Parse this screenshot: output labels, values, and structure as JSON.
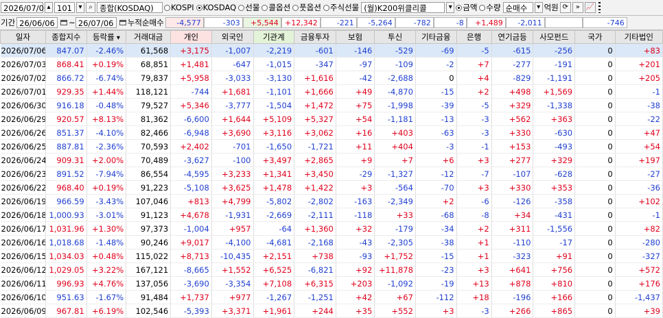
{
  "toolbar": {
    "date": "2026/07/06",
    "code": "101",
    "index_name": "종합(KOSDAQ)",
    "markets": [
      {
        "label": "KOSPI",
        "checked": false
      },
      {
        "label": "KOSDAQ",
        "checked": true
      },
      {
        "label": "선물",
        "checked": false
      },
      {
        "label": "콜옵션",
        "checked": false
      },
      {
        "label": "풋옵션",
        "checked": false
      },
      {
        "label": "주식선물",
        "checked": false
      }
    ],
    "unit": "(월)K200위클리콜",
    "measures": [
      {
        "label": "금액",
        "checked": true
      },
      {
        "label": "수량",
        "checked": false
      }
    ],
    "mode": "순매수",
    "amount_unit": "억원"
  },
  "period": {
    "label": "기간",
    "from": "26/06/06",
    "tilde": "~",
    "to": "26/07/06",
    "sum_label": "누적순매수",
    "sums": [
      "-4,577",
      "-303",
      "+5,544",
      "+12,342",
      "-221",
      "-5,264",
      "-782",
      "-8",
      "+1,489",
      "-2,011",
      "",
      "-746"
    ]
  },
  "headers": [
    "일자",
    "종합지수",
    "등락률",
    "거래대금",
    "개인",
    "외국인",
    "기관계",
    "금융투자",
    "보험",
    "투신",
    "기타금융",
    "은행",
    "연기금등",
    "사모펀드",
    "국가",
    "기타법인"
  ],
  "rows": [
    [
      "2026/07/06",
      "847.07",
      "-2.46%",
      "61,568",
      "+3,175",
      "-1,007",
      "-2,219",
      "-601",
      "-146",
      "-529",
      "-69",
      "-5",
      "-615",
      "-256",
      "0",
      "+83"
    ],
    [
      "2026/07/03",
      "868.41",
      "+0.19%",
      "68,851",
      "+1,481",
      "-647",
      "-1,015",
      "-347",
      "-97",
      "-109",
      "-2",
      "+7",
      "-277",
      "-191",
      "0",
      "+201"
    ],
    [
      "2026/07/02",
      "866.72",
      "-6.74%",
      "79,837",
      "+5,958",
      "-3,033",
      "-3,130",
      "+1,616",
      "-42",
      "-2,688",
      "0",
      "+4",
      "-829",
      "-1,191",
      "0",
      "+205"
    ],
    [
      "2026/07/01",
      "929.35",
      "+1.44%",
      "118,121",
      "-744",
      "+1,681",
      "-1,101",
      "+1,666",
      "+49",
      "-4,870",
      "-15",
      "+2",
      "+498",
      "+1,569",
      "0",
      "-1"
    ],
    [
      "2026/06/30",
      "916.18",
      "-0.48%",
      "79,527",
      "+5,346",
      "-3,777",
      "-1,504",
      "+1,472",
      "+75",
      "-1,998",
      "-39",
      "-5",
      "+329",
      "-1,338",
      "0",
      "-38"
    ],
    [
      "2026/06/29",
      "920.57",
      "+8.13%",
      "81,362",
      "-6,600",
      "+1,644",
      "+5,109",
      "+5,327",
      "+54",
      "-1,181",
      "-13",
      "-3",
      "+562",
      "+363",
      "0",
      "-22"
    ],
    [
      "2026/06/26",
      "851.37",
      "-4.10%",
      "82,466",
      "-6,948",
      "+3,690",
      "+3,116",
      "+3,062",
      "+16",
      "+403",
      "-63",
      "-3",
      "+330",
      "-630",
      "0",
      "+47"
    ],
    [
      "2026/06/25",
      "887.81",
      "-2.36%",
      "70,593",
      "+2,402",
      "-701",
      "-1,650",
      "-1,721",
      "+11",
      "+404",
      "-3",
      "-1",
      "+153",
      "-493",
      "0",
      "+54"
    ],
    [
      "2026/06/24",
      "909.31",
      "+2.00%",
      "70,489",
      "-3,627",
      "-100",
      "+3,497",
      "+2,865",
      "+9",
      "+7",
      "+6",
      "+3",
      "+277",
      "+329",
      "0",
      "+197"
    ],
    [
      "2026/06/23",
      "891.52",
      "-7.94%",
      "86,554",
      "-4,595",
      "+3,233",
      "+1,341",
      "+3,450",
      "-29",
      "-1,327",
      "-12",
      "-7",
      "-107",
      "-628",
      "0",
      "-27"
    ],
    [
      "2026/06/22",
      "968.40",
      "+0.19%",
      "91,223",
      "-5,108",
      "+3,625",
      "+1,478",
      "+1,422",
      "+3",
      "-564",
      "-70",
      "+3",
      "+330",
      "+353",
      "0",
      "-36"
    ],
    [
      "2026/06/19",
      "966.59",
      "-3.43%",
      "107,046",
      "+813",
      "+4,799",
      "-5,802",
      "-2,802",
      "-163",
      "-2,349",
      "+2",
      "-6",
      "-126",
      "-358",
      "0",
      "+102"
    ],
    [
      "2026/06/18",
      "1,000.93",
      "-3.01%",
      "91,123",
      "+4,678",
      "-1,931",
      "-2,669",
      "-2,111",
      "-118",
      "+33",
      "-68",
      "-8",
      "+34",
      "-431",
      "0",
      "-1"
    ],
    [
      "2026/06/17",
      "1,031.96",
      "+1.30%",
      "97,373",
      "-1,004",
      "+957",
      "-64",
      "+1,360",
      "+32",
      "-179",
      "-34",
      "+2",
      "+311",
      "-1,556",
      "0",
      "+82"
    ],
    [
      "2026/06/16",
      "1,018.68",
      "-1.48%",
      "90,246",
      "+9,017",
      "-4,100",
      "-4,681",
      "-2,168",
      "-43",
      "-2,305",
      "-38",
      "+1",
      "-110",
      "-17",
      "0",
      "-280"
    ],
    [
      "2026/06/15",
      "1,034.03",
      "+0.48%",
      "115,022",
      "+8,713",
      "-10,435",
      "+2,151",
      "+738",
      "-93",
      "+1,752",
      "-15",
      "+1",
      "-323",
      "+91",
      "0",
      "-327"
    ],
    [
      "2026/06/12",
      "1,029.05",
      "+3.22%",
      "167,121",
      "-8,665",
      "+1,552",
      "+6,525",
      "-6,821",
      "+92",
      "+11,878",
      "-23",
      "+3",
      "+641",
      "+756",
      "0",
      "+572"
    ],
    [
      "2026/06/11",
      "996.93",
      "+4.76%",
      "137,056",
      "-3,690",
      "-3,354",
      "+7,108",
      "+6,315",
      "+203",
      "-1,092",
      "-19",
      "+13",
      "+878",
      "+810",
      "0",
      "+176"
    ],
    [
      "2026/06/10",
      "951.63",
      "-1.67%",
      "91,484",
      "+1,737",
      "+977",
      "-1,267",
      "-1,251",
      "+42",
      "+67",
      "-112",
      "+18",
      "-196",
      "+166",
      "0",
      "-1,437"
    ],
    [
      "2026/06/09",
      "967.81",
      "+6.19%",
      "102,546",
      "-5,393",
      "+3,371",
      "+1,961",
      "+244",
      "+35",
      "+552",
      "+3",
      "-3",
      "+266",
      "+865",
      "0",
      "+39"
    ]
  ],
  "colors": {
    "up": "#e0001b",
    "down": "#1f3fd1",
    "selected_row": "#dbe8f8"
  }
}
